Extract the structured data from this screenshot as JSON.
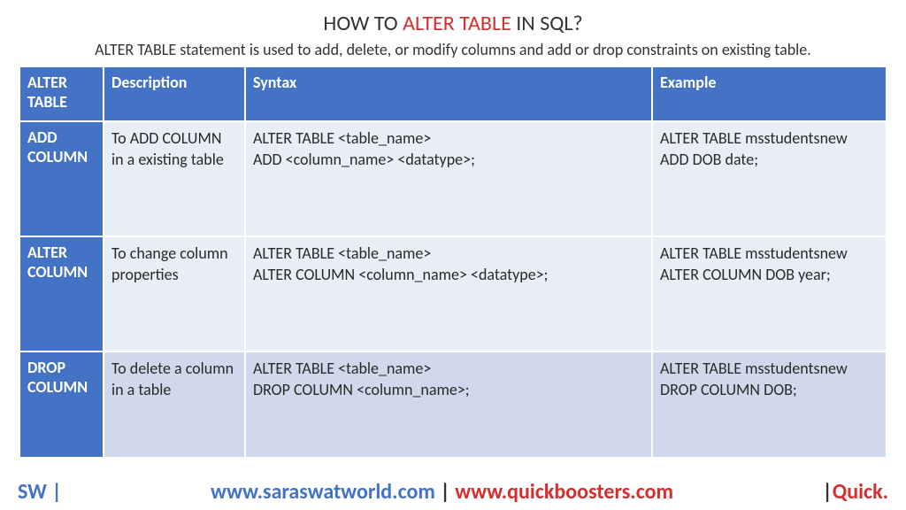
{
  "title": {
    "prefix": "HOW TO ",
    "highlight": "ALTER TABLE",
    "suffix": " IN SQL?"
  },
  "subtitle": "ALTER TABLE statement is used to add, delete, or modify columns and add or drop constraints on existing table.",
  "headers": {
    "col0": "ALTER TABLE",
    "col1": "Description",
    "col2": "Syntax",
    "col3": "Example"
  },
  "rows": [
    {
      "name": "ADD COLUMN",
      "description": "To  ADD  COLUMN in a existing table",
      "syntax": "ALTER TABLE <table_name>\nADD <column_name> <datatype>;",
      "example": "ALTER TABLE msstudentsnew\nADD DOB date;"
    },
    {
      "name": "ALTER COLUMN",
      "description": "To change column properties",
      "syntax": "ALTER TABLE <table_name>\nALTER COLUMN <column_name> <datatype>;",
      "example": "ALTER TABLE msstudentsnew\nALTER COLUMN DOB year;"
    },
    {
      "name": "DROP COLUMN",
      "description": "To delete a column in a table",
      "syntax": "ALTER TABLE <table_name>\nDROP COLUMN <column_name>;",
      "example": "ALTER TABLE msstudentsnew\nDROP COLUMN DOB;"
    }
  ],
  "footer": {
    "left": "SW |",
    "url1": "www.saraswatworld.com",
    "sep": " | ",
    "url2": "www.quickboosters.com",
    "rightBar": "|",
    "right": "Quick."
  }
}
